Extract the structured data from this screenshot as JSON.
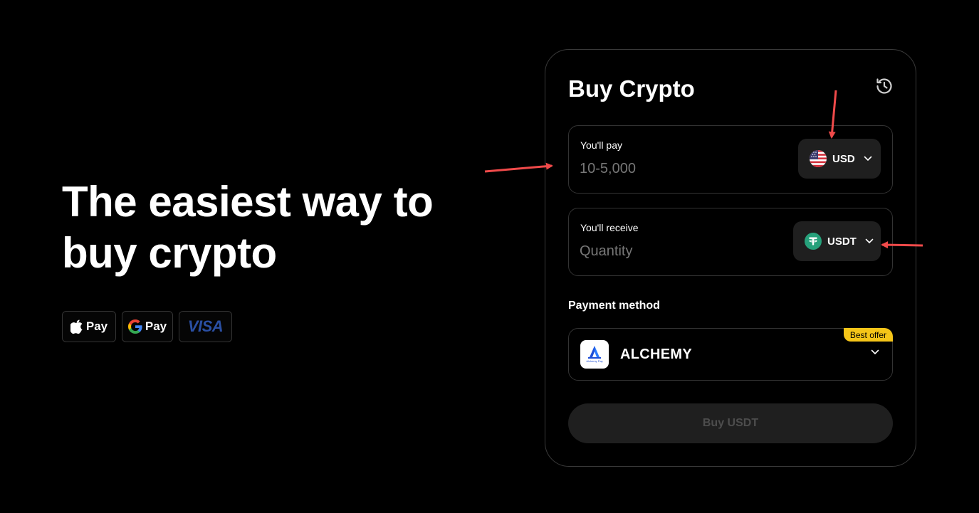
{
  "hero": {
    "title_line1": "The easiest way to",
    "title_line2": "buy crypto",
    "badges": {
      "apple_pay_label": "Pay",
      "google_pay_label": "Pay",
      "visa_label": "VISA"
    }
  },
  "widget": {
    "title": "Buy Crypto",
    "history_icon": "history-icon",
    "pay": {
      "label": "You'll pay",
      "placeholder": "10-5,000",
      "value": "",
      "currency": "USD",
      "currency_icon": "us-flag-icon"
    },
    "receive": {
      "label": "You'll receive",
      "placeholder": "Quantity",
      "value": "",
      "currency": "USDT",
      "currency_icon": "tether-icon"
    },
    "payment": {
      "section_label": "Payment method",
      "provider": "ALCHEMY",
      "provider_logo_text": "Alchemy Pay",
      "badge": "Best offer"
    },
    "submit_label": "Buy USDT"
  },
  "colors": {
    "background": "#000000",
    "border": "#333333",
    "button_bg": "#1f1f1f",
    "best_offer": "#f5c518",
    "tether": "#26a17b",
    "annotation_arrow": "#f04a4a"
  }
}
